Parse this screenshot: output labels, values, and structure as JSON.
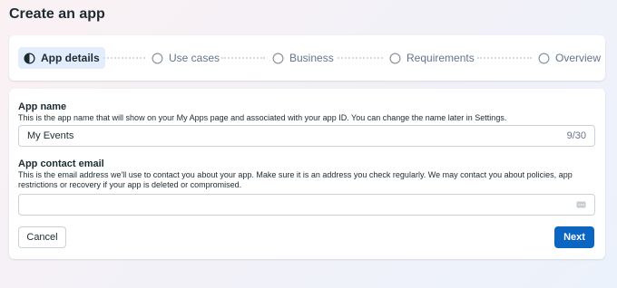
{
  "page": {
    "title": "Create an app"
  },
  "stepper": {
    "steps": [
      {
        "label": "App details",
        "state": "active"
      },
      {
        "label": "Use cases",
        "state": "pending"
      },
      {
        "label": "Business",
        "state": "pending"
      },
      {
        "label": "Requirements",
        "state": "pending"
      },
      {
        "label": "Overview",
        "state": "pending"
      }
    ]
  },
  "form": {
    "app_name": {
      "label": "App name",
      "help": "This is the app name that will show on your My Apps page and associated with your app ID. You can change the name later in Settings.",
      "value": "My Events",
      "count": "9/30"
    },
    "contact_email": {
      "label": "App contact email",
      "help": "This is the email address we'll use to contact you about your app. Make sure it is an address you check regularly. We may contact you about policies, app restrictions or recovery if your app is deleted or compromised.",
      "value": ""
    }
  },
  "actions": {
    "cancel_label": "Cancel",
    "next_label": "Next"
  },
  "colors": {
    "accent": "#0a66c2",
    "active_step_bg": "#e3eefc",
    "text": "#1c2b33",
    "muted": "#65758c"
  }
}
